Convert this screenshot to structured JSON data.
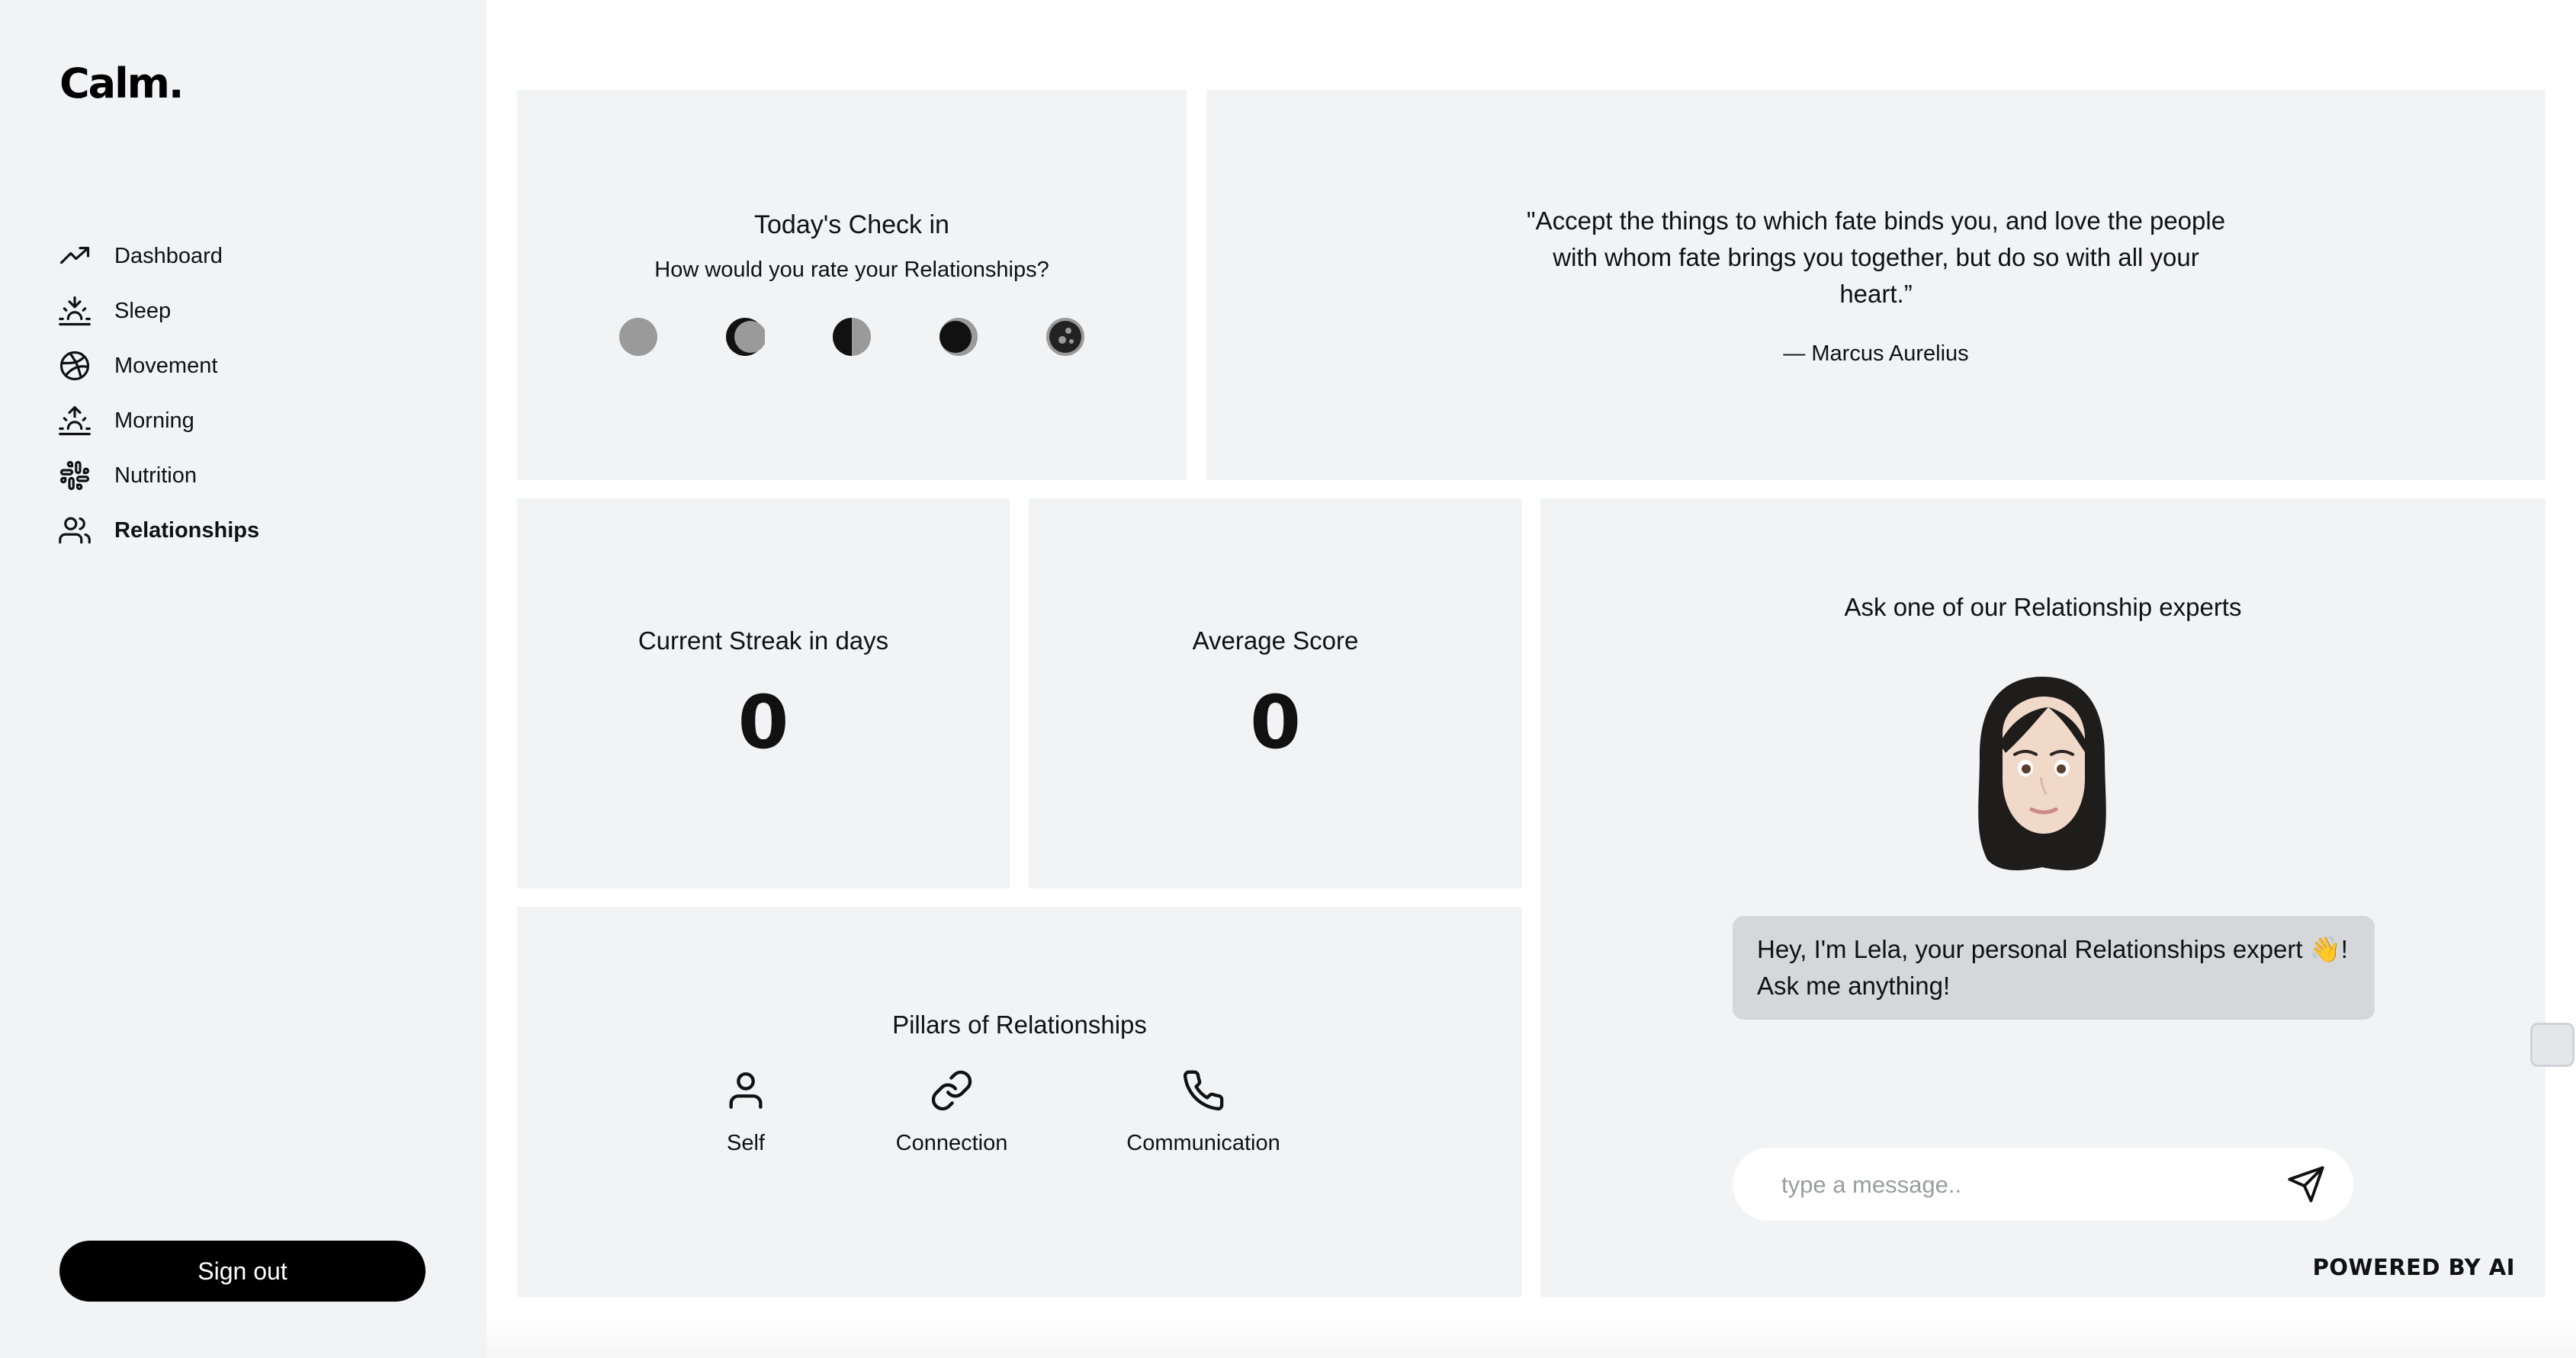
{
  "app": {
    "logo": "Calm."
  },
  "sidebar": {
    "items": [
      {
        "label": "Dashboard",
        "icon": "trending-up-icon"
      },
      {
        "label": "Sleep",
        "icon": "sunset-icon"
      },
      {
        "label": "Movement",
        "icon": "basketball-icon"
      },
      {
        "label": "Morning",
        "icon": "sunrise-icon"
      },
      {
        "label": "Nutrition",
        "icon": "slack-icon"
      },
      {
        "label": "Relationships",
        "icon": "users-icon",
        "active": true
      }
    ],
    "signout_label": "Sign out"
  },
  "checkin": {
    "title": "Today's Check in",
    "question": "How would you rate your Relationships?",
    "options": [
      "new-moon-icon",
      "waxing-crescent-icon",
      "half-moon-icon",
      "waning-gibbous-icon",
      "full-moon-icon"
    ]
  },
  "quote": {
    "text": "\"Accept the things to which fate binds you, and love the people with whom fate brings you together, but do so with all your heart.”",
    "author": "— Marcus Aurelius"
  },
  "streak": {
    "title": "Current Streak in days",
    "value": "0"
  },
  "average": {
    "title": "Average Score",
    "value": "0"
  },
  "pillars": {
    "title": "Pillars of Relationships",
    "items": [
      {
        "label": "Self",
        "icon": "user-icon"
      },
      {
        "label": "Connection",
        "icon": "link-icon"
      },
      {
        "label": "Communication",
        "icon": "phone-icon"
      }
    ]
  },
  "chat": {
    "title": "Ask one of our Relationship experts",
    "message": "Hey, I'm Lela, your personal Relationships expert 👋! Ask me anything!",
    "input_placeholder": "type a message..",
    "powered": "POWERED BY AI"
  },
  "colors": {
    "panel": "#f2f3f5",
    "bubble": "#d5d7da",
    "button": "#000000"
  }
}
